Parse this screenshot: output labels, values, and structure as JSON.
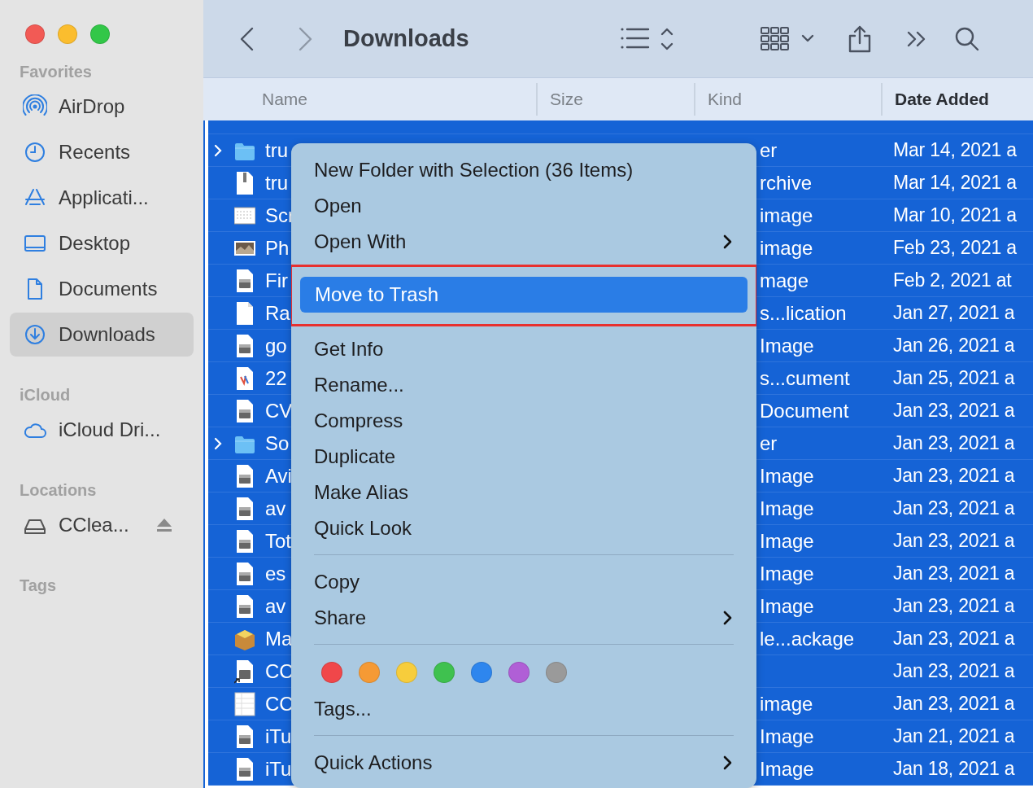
{
  "window": {
    "title": "Downloads"
  },
  "sidebar": {
    "sections": [
      {
        "title": "Favorites",
        "items": [
          {
            "label": "AirDrop",
            "kind": "airdrop",
            "selected": false
          },
          {
            "label": "Recents",
            "kind": "recents",
            "selected": false
          },
          {
            "label": "Applicati...",
            "kind": "applications",
            "selected": false
          },
          {
            "label": "Desktop",
            "kind": "desktop",
            "selected": false
          },
          {
            "label": "Documents",
            "kind": "documents",
            "selected": false
          },
          {
            "label": "Downloads",
            "kind": "downloads",
            "selected": true
          }
        ]
      },
      {
        "title": "iCloud",
        "items": [
          {
            "label": "iCloud Dri...",
            "kind": "icloud",
            "selected": false
          }
        ]
      },
      {
        "title": "Locations",
        "items": [
          {
            "label": "CClea...",
            "kind": "volume",
            "selected": false,
            "ejectable": true
          }
        ]
      },
      {
        "title": "Tags"
      }
    ]
  },
  "table": {
    "columns": [
      {
        "label": "Name",
        "sorted": false
      },
      {
        "label": "Size",
        "sorted": false
      },
      {
        "label": "Kind",
        "sorted": false
      },
      {
        "label": "Date Added",
        "sorted": true
      }
    ],
    "rows": [
      {
        "kind": "folder",
        "expanded": false,
        "name": "tru",
        "file_kind": "er",
        "date": "Mar 14, 2021 a",
        "selected": true
      },
      {
        "kind": "archive",
        "name": "tru",
        "file_kind": "rchive",
        "date": "Mar 14, 2021 a",
        "selected": true
      },
      {
        "kind": "screenshot",
        "name": "Scr",
        "file_kind": "image",
        "date": "Mar 10, 2021 a",
        "selected": true
      },
      {
        "kind": "photo",
        "name": "Ph",
        "file_kind": "image",
        "date": "Feb 23, 2021 a",
        "selected": true
      },
      {
        "kind": "disk",
        "name": "Fir",
        "file_kind": "mage",
        "date": "Feb 2, 2021 at",
        "selected": true
      },
      {
        "kind": "blank",
        "name": "Ra",
        "file_kind": "s...lication",
        "date": "Jan 27, 2021 a",
        "selected": true
      },
      {
        "kind": "disk",
        "name": "go",
        "file_kind": "Image",
        "date": "Jan 26, 2021 a",
        "selected": true
      },
      {
        "kind": "document",
        "name": "22",
        "file_kind": "s...cument",
        "date": "Jan 25, 2021 a",
        "selected": true
      },
      {
        "kind": "disk",
        "name": "CV",
        "file_kind": "Document",
        "date": "Jan 23, 2021 a",
        "selected": true
      },
      {
        "kind": "folder",
        "expanded": false,
        "name": "So",
        "file_kind": "er",
        "date": "Jan 23, 2021 a",
        "selected": true
      },
      {
        "kind": "disk",
        "name": "Avi",
        "file_kind": "Image",
        "date": "Jan 23, 2021 a",
        "selected": true
      },
      {
        "kind": "disk",
        "name": "av",
        "file_kind": "Image",
        "date": "Jan 23, 2021 a",
        "selected": true
      },
      {
        "kind": "disk",
        "name": "Tot",
        "file_kind": "Image",
        "date": "Jan 23, 2021 a",
        "selected": true
      },
      {
        "kind": "disk",
        "name": "es",
        "file_kind": "Image",
        "date": "Jan 23, 2021 a",
        "selected": true
      },
      {
        "kind": "disk",
        "name": "av",
        "file_kind": "Image",
        "date": "Jan 23, 2021 a",
        "selected": true
      },
      {
        "kind": "package",
        "name": "Ma",
        "file_kind": "le...ackage",
        "date": "Jan 23, 2021 a",
        "selected": true
      },
      {
        "kind": "alias",
        "name": "CC",
        "date": "Jan 23, 2021 a",
        "selected": true
      },
      {
        "kind": "sheet",
        "name": "CC",
        "file_kind": "image",
        "date": "Jan 23, 2021 a",
        "selected": true
      },
      {
        "kind": "disk",
        "name": "iTu",
        "file_kind": "Image",
        "date": "Jan 21, 2021 a",
        "selected": true
      },
      {
        "kind": "disk",
        "name": "iTu",
        "file_kind": "Image",
        "date": "Jan 18, 2021 a",
        "selected": true
      }
    ]
  },
  "context_menu": {
    "items": [
      {
        "kind": "item",
        "label": "New Folder with Selection (36 Items)",
        "selected": false
      },
      {
        "kind": "item",
        "label": "Open",
        "selected": false
      },
      {
        "kind": "item",
        "label": "Open With",
        "selected": false,
        "submenu": true
      },
      {
        "kind": "item",
        "label": "Move to Trash",
        "selected": true,
        "annotated": true
      },
      {
        "kind": "item",
        "label": "Get Info",
        "selected": false
      },
      {
        "kind": "item",
        "label": "Rename...",
        "selected": false
      },
      {
        "kind": "item",
        "label": "Compress",
        "selected": false
      },
      {
        "kind": "item",
        "label": "Duplicate",
        "selected": false
      },
      {
        "kind": "item",
        "label": "Make Alias",
        "selected": false
      },
      {
        "kind": "item",
        "label": "Quick Look",
        "selected": false
      },
      {
        "kind": "separator"
      },
      {
        "kind": "item",
        "label": "Copy",
        "selected": false
      },
      {
        "kind": "item",
        "label": "Share",
        "selected": false,
        "submenu": true
      },
      {
        "kind": "separator"
      },
      {
        "kind": "tags",
        "colors": [
          {
            "color": "#f0474a"
          },
          {
            "color": "#f59a35"
          },
          {
            "color": "#f7cd3c"
          },
          {
            "color": "#3fc14f"
          },
          {
            "color": "#2e86ee"
          },
          {
            "color": "#b05fd6"
          },
          {
            "color": "#9a9a9a"
          }
        ]
      },
      {
        "kind": "item",
        "label": "Tags...",
        "selected": false
      },
      {
        "kind": "separator"
      },
      {
        "kind": "item",
        "label": "Quick Actions",
        "selected": false,
        "submenu": true
      }
    ]
  }
}
